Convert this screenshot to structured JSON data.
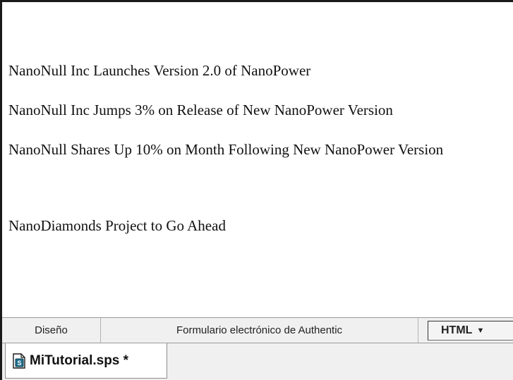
{
  "headlines": [
    "NanoNull Inc Launches Version 2.0 of NanoPower",
    "NanoNull Inc Jumps 3% on Release of New NanoPower Version",
    "NanoNull Shares Up 10% on Month Following New NanoPower Version",
    "NanoDiamonds Project to Go Ahead"
  ],
  "view_tabs": {
    "design": "Diseño",
    "authentic": "Formulario electrónico de Authentic",
    "html": "HTML",
    "html_caret": "▼"
  },
  "document_tab": {
    "name": "MiTutorial.sps *",
    "icon": "sps-file-icon"
  }
}
